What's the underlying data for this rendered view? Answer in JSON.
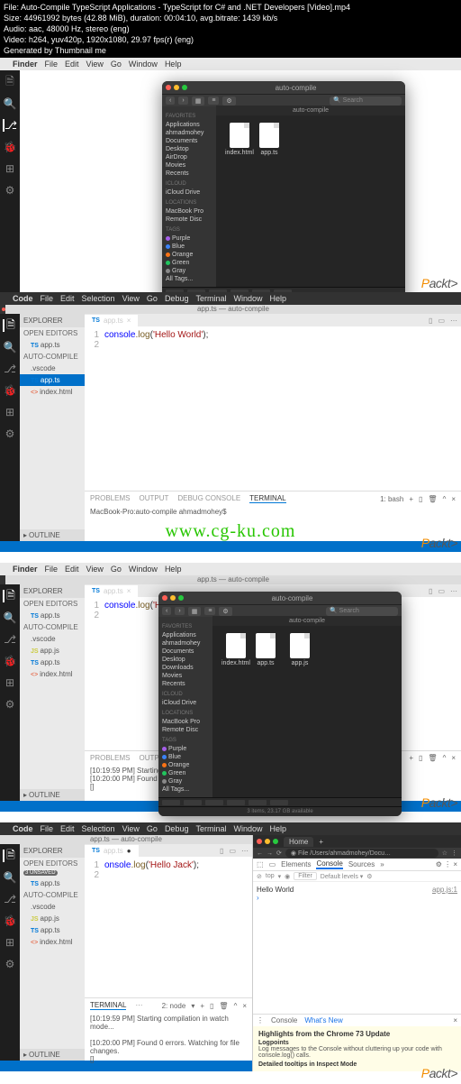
{
  "video_meta": {
    "file": "File: Auto-Compile TypeScript Applications - TypeScript for C# and .NET Developers [Video].mp4",
    "size": "Size: 44961992 bytes (42.88 MiB), duration: 00:04:10, avg.bitrate: 1439 kb/s",
    "audio": "Audio: aac, 48000 Hz, stereo (eng)",
    "video": "Video: h264, yuv420p, 1920x1080, 29.97 fps(r) (eng)",
    "gen": "Generated by Thumbnail me"
  },
  "menubar_finder": {
    "app": "Finder",
    "items": [
      "File",
      "Edit",
      "View",
      "Go",
      "Window",
      "Help"
    ]
  },
  "menubar_code": {
    "app": "Code",
    "items": [
      "File",
      "Edit",
      "Selection",
      "View",
      "Go",
      "Debug",
      "Terminal",
      "Window",
      "Help"
    ]
  },
  "finder": {
    "title": "auto-compile",
    "path_label": "auto-compile",
    "search_placeholder": "Search",
    "status": "3 items, 23.17 GB available",
    "favorites_head": "Favorites",
    "favorites": [
      "Applications",
      "ahmadmohey",
      "Documents",
      "Desktop",
      "AirDrop",
      "Movies",
      "Recents"
    ],
    "icloud_head": "iCloud",
    "icloud": [
      "iCloud Drive"
    ],
    "locations_head": "Locations",
    "locations": [
      "MacBook Pro",
      "Remote Disc"
    ],
    "tags_head": "Tags",
    "tags": [
      {
        "name": "Purple",
        "color": "#a55eea"
      },
      {
        "name": "Blue",
        "color": "#3b82f6"
      },
      {
        "name": "Orange",
        "color": "#f97316"
      },
      {
        "name": "Green",
        "color": "#22c55e"
      },
      {
        "name": "Gray",
        "color": "#888"
      },
      {
        "name": "All Tags...",
        "color": ""
      }
    ],
    "files_a": [
      "index.html",
      "app.ts"
    ],
    "files_b": [
      "index.html",
      "app.ts",
      "app.js"
    ]
  },
  "finder2": {
    "downloads": "Downloads"
  },
  "explorer": {
    "title": "EXPLORER",
    "open_editors": "OPEN EDITORS",
    "project": "AUTO-COMPILE",
    "outline": "OUTLINE",
    "unsaved_badge": "3 UNSAVED",
    "items": {
      "vscode": ".vscode",
      "appts": "app.ts",
      "indexhtml": "index.html",
      "appjs": "app.js"
    }
  },
  "editor": {
    "window_title": "app.ts — auto-compile",
    "tab": "app.ts",
    "line1": {
      "console": "console",
      "log": ".log",
      "paren1": "(",
      "str_hw": "'Hello World'",
      "str_hj": "'Hello Jack'",
      "paren2": ");"
    }
  },
  "terminal": {
    "tabs": [
      "PROBLEMS",
      "OUTPUT",
      "DEBUG CONSOLE",
      "TERMINAL"
    ],
    "shell_bash": "1: bash",
    "shell_node": "2: node",
    "prompt": "MacBook-Pro:auto-compile ahmadmohey$",
    "msg_start": "[10:19:59 PM] Starting compilation in watch mode...",
    "msg_found": "[10:20:00 PM] Found 0 errors. Watching for file changes.",
    "msg_start_short": "[10:19:59 PM] Starting co",
    "msg_found_short": "[10:20:00 PM] Found 0 er",
    "brackets": "[]"
  },
  "browser": {
    "tab_title": "Home",
    "address": "File   /Users/ahmadmohey/Docu…",
    "devtabs": [
      "Elements",
      "Console",
      "Sources"
    ],
    "top": "top",
    "filter": "Filter",
    "levels": "Default levels ▾",
    "console_msg": "Hello World",
    "console_src": "app.js:1",
    "drawer": {
      "console": "Console",
      "whatsnew": "What's New",
      "headline": "Highlights from the Chrome 73 Update",
      "logpoints": "Logpoints",
      "logpoints_desc": "Log messages to the Console without cluttering up your code with console.log() calls.",
      "tooltips": "Detailed tooltips in Inspect Mode"
    }
  },
  "watermark": "www.cg-ku.com",
  "packt_p": "P",
  "packt_rest": "ackt>"
}
